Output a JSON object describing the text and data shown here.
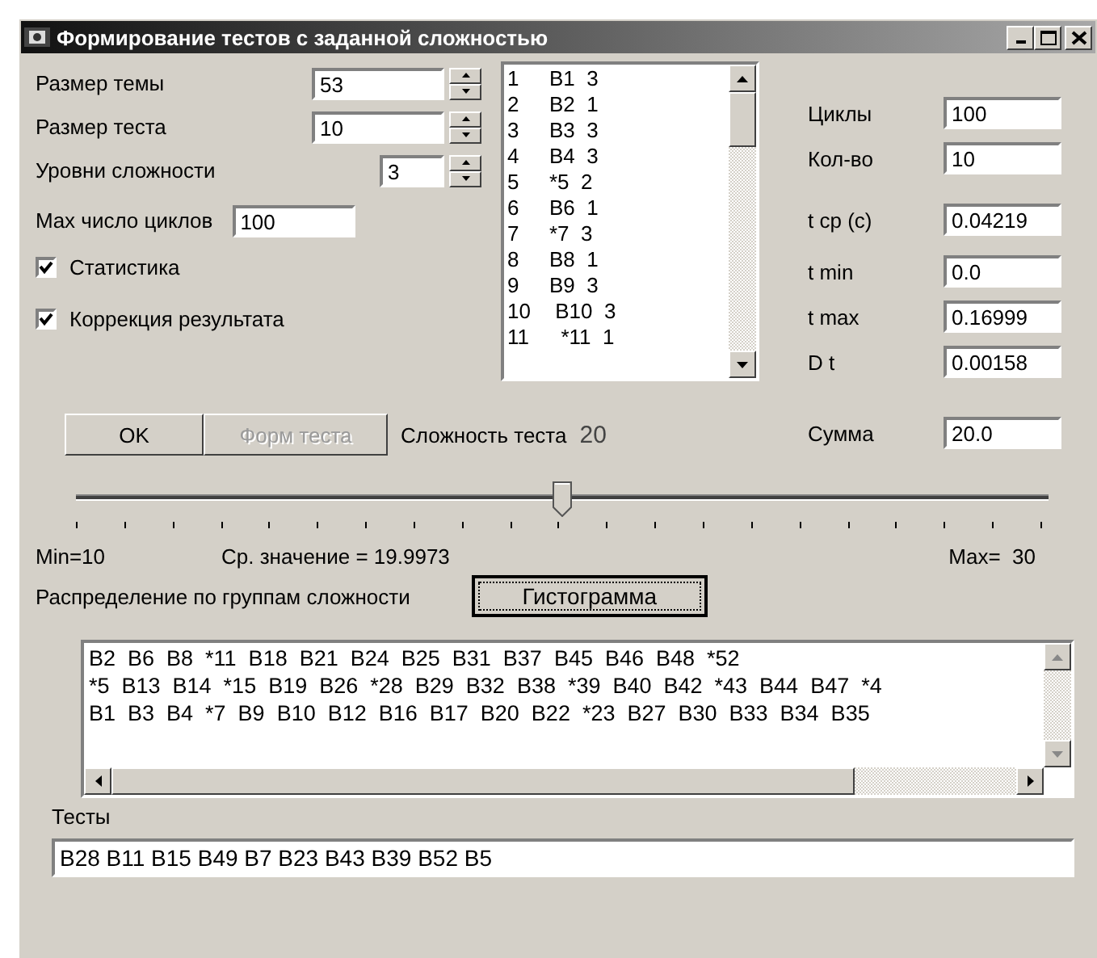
{
  "window": {
    "title": "Формирование тестов с заданной сложностью"
  },
  "params": [
    {
      "label": "Размер темы",
      "value": "53",
      "kind": "wide"
    },
    {
      "label": "Размер теста",
      "value": "10",
      "kind": "wide"
    },
    {
      "label": "Уровни сложности",
      "value": "3",
      "kind": "narrow"
    }
  ],
  "max_cycles": {
    "label": "Max число циклов",
    "value": "100"
  },
  "checkboxes": [
    {
      "label": "Статистика",
      "checked": true
    },
    {
      "label": "Коррекция результата",
      "checked": true
    }
  ],
  "question_list": [
    {
      "number": "1",
      "entry": "В1  3"
    },
    {
      "number": "2",
      "entry": "В2  1"
    },
    {
      "number": "3",
      "entry": "В3  3"
    },
    {
      "number": "4",
      "entry": "В4  3"
    },
    {
      "number": "5",
      "entry": "*5  2"
    },
    {
      "number": "6",
      "entry": "В6  1"
    },
    {
      "number": "7",
      "entry": "*7  3"
    },
    {
      "number": "8",
      "entry": "В8  1"
    },
    {
      "number": "9",
      "entry": "В9  3"
    },
    {
      "number": "10",
      "entry": " В10  3"
    },
    {
      "number": "11",
      "entry": "  *11  1"
    }
  ],
  "stats": [
    {
      "label": "Циклы",
      "value": "100"
    },
    {
      "label": "Кол-во",
      "value": "10"
    },
    {
      "label": "t ср (с)",
      "value": "0.04219"
    },
    {
      "label": "t min",
      "value": "0.0"
    },
    {
      "label": "t max",
      "value": "0.16999"
    },
    {
      "label": "D t",
      "value": "0.00158"
    }
  ],
  "sum": {
    "label": "Сумма",
    "value": "20.0"
  },
  "buttons": [
    {
      "label": "OK",
      "disabled": false
    },
    {
      "label": "Форм теста",
      "disabled": true
    }
  ],
  "difficulty": {
    "label": "Сложность теста",
    "value": "20"
  },
  "slider": {
    "level": 0.5
  },
  "min_label": "Min=10",
  "mean_label": "Ср. значение = 19.9973",
  "max_label": "Max=  30",
  "distribution_label": "Распределение по группам сложности",
  "histogram_button": "Гистограмма",
  "group_lines": [
    "В2  В6  В8  *11  В18  В21  В24  В25  В31  В37  В45  В46  В48  *52",
    "*5  В13  В14  *15  В19  В26  *28  В29  В32  В38  *39  В40  В42  *43  В44  В47  *4",
    "В1  В3  В4  *7  В9  В10  В12  В16  В17  В20  В22  *23  В27  В30  В33  В34  В35"
  ],
  "tests": {
    "label": "Тесты",
    "value": "В28  В11  В15  В49  В7  В23  В43  В39  В52  В5"
  }
}
